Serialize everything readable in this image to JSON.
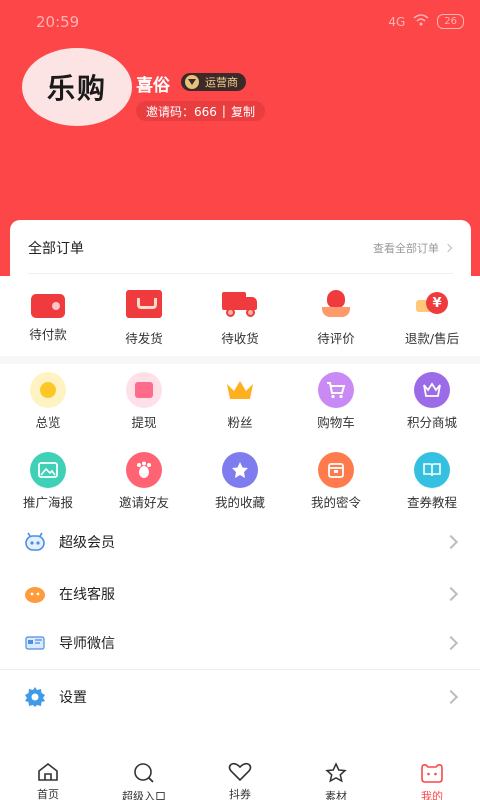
{
  "status_bar": {
    "time": "20:59",
    "signal": "4G",
    "battery": "26"
  },
  "profile": {
    "avatar_text": "乐购",
    "username": "喜俗",
    "role": "运营商",
    "invite_label": "邀请码：666",
    "invite_separator": "|",
    "copy_label": "复制"
  },
  "orders": {
    "title": "全部订单",
    "view_all": "查看全部订单",
    "items": [
      {
        "label": "待付款",
        "icon": "wallet-icon"
      },
      {
        "label": "待发货",
        "icon": "package-icon"
      },
      {
        "label": "待收货",
        "icon": "truck-icon"
      },
      {
        "label": "待评价",
        "icon": "flower-icon"
      },
      {
        "label": "退款/售后",
        "icon": "refund-icon"
      }
    ]
  },
  "tools": {
    "row1": [
      {
        "label": "总览",
        "icon": "overview-icon",
        "color": "#ffc628"
      },
      {
        "label": "提现",
        "icon": "withdraw-icon",
        "color": "#ff6b8a"
      },
      {
        "label": "粉丝",
        "icon": "crown-icon",
        "color": "#ffb01f"
      },
      {
        "label": "购物车",
        "icon": "cart-icon",
        "color": "#c98af5"
      },
      {
        "label": "积分商城",
        "icon": "mall-icon",
        "color": "#9c6ce8"
      }
    ],
    "row2": [
      {
        "label": "推广海报",
        "icon": "poster-icon",
        "color": "#3fd0b6"
      },
      {
        "label": "邀请好友",
        "icon": "invite-icon",
        "color": "#ff6374"
      },
      {
        "label": "我的收藏",
        "icon": "star-icon",
        "color": "#7f7cf0"
      },
      {
        "label": "我的密令",
        "icon": "secret-icon",
        "color": "#ff7a4d"
      },
      {
        "label": "查券教程",
        "icon": "tutorial-icon",
        "color": "#34c0e0"
      }
    ]
  },
  "menu": [
    {
      "label": "超级会员",
      "icon": "vip-icon"
    },
    {
      "label": "在线客服",
      "icon": "service-icon"
    },
    {
      "label": "导师微信",
      "icon": "wechat-icon"
    },
    {
      "label": "设置",
      "icon": "settings-icon"
    }
  ],
  "bottom_nav": [
    {
      "label": "首页",
      "icon": "home-icon"
    },
    {
      "label": "超级入口",
      "icon": "search-icon"
    },
    {
      "label": "抖券",
      "icon": "heart-icon"
    },
    {
      "label": "素材",
      "icon": "star-outline-icon"
    },
    {
      "label": "我的",
      "icon": "profile-icon",
      "active": true
    }
  ],
  "colors": {
    "brand_red": "#fd4648",
    "gold": "#f0cf8a"
  }
}
